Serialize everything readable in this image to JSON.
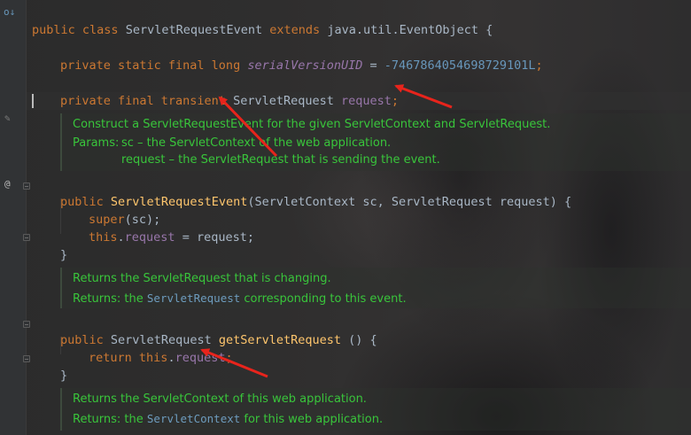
{
  "editor": {
    "class_decl": {
      "kw_public": "public",
      "kw_class": "class",
      "name": "ServletRequestEvent",
      "kw_extends": "extends",
      "parent": "java.util.EventObject",
      "brace": "{"
    },
    "serial": {
      "mods": "private static final long",
      "name": "serialVersionUID",
      "eq": " = ",
      "value": "-7467864054698729101L",
      "semi": ";"
    },
    "request_field": {
      "mods": "private final transient",
      "type": "ServletRequest",
      "name": "request",
      "semi": ";"
    },
    "doc1": {
      "line1": "Construct a ServletRequestEvent for the given ServletContext and ServletRequest.",
      "params_label": "Params:",
      "param1": "sc – the ServletContext of the web application.",
      "param2": "request – the ServletRequest that is sending the event."
    },
    "ctor": {
      "kw": "public",
      "name": "ServletRequestEvent",
      "params_open": "(ServletContext sc, ServletRequest request) {",
      "super_kw": "super",
      "super_args": "(sc);",
      "this_kw": "this",
      "dot": ".",
      "field": "request",
      "assign": " = request;",
      "close": "}"
    },
    "doc2": {
      "line1": "Returns the ServletRequest that is changing.",
      "returns_label": "Returns: the",
      "returns_code": "ServletRequest",
      "returns_rest": "corresponding to this event."
    },
    "getter": {
      "kw": "public",
      "type": "ServletRequest",
      "name": "getServletRequest",
      "rest": " () {",
      "return_kw": "return",
      "this_kw": "this",
      "dot": ".",
      "field": "request",
      "semi": ";",
      "close": "}"
    },
    "doc3": {
      "line1": "Returns the ServletContext of this web application.",
      "returns_label": "Returns: the",
      "returns_code": "ServletContext",
      "returns_rest": "for this web application."
    }
  },
  "gutter": {
    "class_icon": "o↓",
    "override_icon": "@"
  },
  "colors": {
    "keyword": "#cc7832",
    "field": "#9876aa",
    "number": "#6897bb",
    "method": "#ffc66d",
    "doc_text": "#39c53b",
    "doc_code": "#6d9cbe",
    "arrow": "#e8241c"
  }
}
